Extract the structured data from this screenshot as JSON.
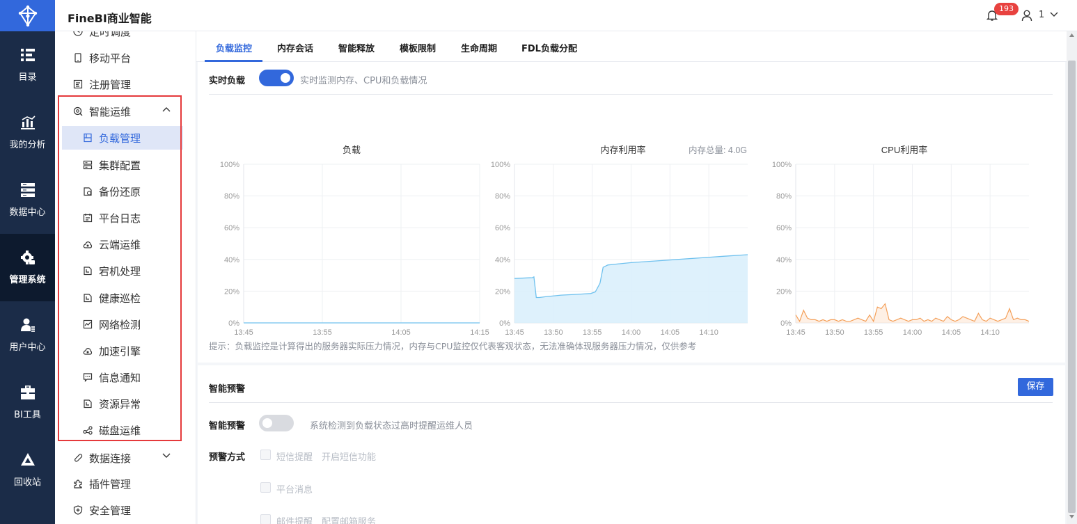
{
  "app": {
    "title": "FineBI商业智能"
  },
  "header": {
    "notification_count": "193",
    "user_name": "1"
  },
  "rail": {
    "items": [
      {
        "label": "目录",
        "icon": "catalog-icon"
      },
      {
        "label": "我的分析",
        "icon": "analysis-icon"
      },
      {
        "label": "数据中心",
        "icon": "data-center-icon"
      },
      {
        "label": "管理系统",
        "icon": "admin-gear-icon",
        "active": true
      },
      {
        "label": "用户中心",
        "icon": "user-center-icon"
      },
      {
        "label": "BI工具",
        "icon": "toolbox-icon"
      },
      {
        "label": "回收站",
        "icon": "recycle-icon"
      }
    ]
  },
  "sidebar": {
    "items": [
      {
        "label": "定时调度",
        "icon": "clock-icon"
      },
      {
        "label": "移动平台",
        "icon": "mobile-icon"
      },
      {
        "label": "注册管理",
        "icon": "register-icon"
      },
      {
        "label": "智能运维",
        "icon": "ops-icon",
        "expanded": true
      },
      {
        "label": "负载管理",
        "icon": "load-icon",
        "selected": true
      },
      {
        "label": "集群配置",
        "icon": "cluster-icon"
      },
      {
        "label": "备份还原",
        "icon": "backup-icon"
      },
      {
        "label": "平台日志",
        "icon": "log-icon"
      },
      {
        "label": "云端运维",
        "icon": "cloud-ops-icon"
      },
      {
        "label": "宕机处理",
        "icon": "downtime-icon"
      },
      {
        "label": "健康巡检",
        "icon": "health-check-icon"
      },
      {
        "label": "网络检测",
        "icon": "network-icon"
      },
      {
        "label": "加速引擎",
        "icon": "engine-icon"
      },
      {
        "label": "信息通知",
        "icon": "message-icon"
      },
      {
        "label": "资源异常",
        "icon": "resource-icon"
      },
      {
        "label": "磁盘运维",
        "icon": "disk-icon"
      },
      {
        "label": "数据连接",
        "icon": "link-icon"
      },
      {
        "label": "插件管理",
        "icon": "plugin-icon"
      },
      {
        "label": "安全管理",
        "icon": "security-icon"
      }
    ]
  },
  "tabs": [
    {
      "label": "负载监控",
      "active": true
    },
    {
      "label": "内存会话"
    },
    {
      "label": "智能释放"
    },
    {
      "label": "模板限制"
    },
    {
      "label": "生命周期"
    },
    {
      "label": "FDL负载分配"
    }
  ],
  "realtime": {
    "label": "实时负载",
    "enabled": true,
    "description": "实时监测内存、CPU和负载情况"
  },
  "hint": "提示：负载监控是计算得出的服务器实际压力情况，内存与CPU监控仅代表客观状态，无法准确体现服务器压力情况，仅供参考",
  "alert": {
    "section_title": "智能预警",
    "save_label": "保存",
    "toggle_label": "智能预警",
    "enabled": false,
    "toggle_description": "系统检测到负载状态过高时提醒运维人员",
    "method_label": "预警方式",
    "methods": [
      {
        "label": "短信提醒",
        "link": "开启短信功能"
      },
      {
        "label": "平台消息",
        "link": ""
      },
      {
        "label": "邮件提醒",
        "link": "配置邮箱服务"
      }
    ]
  },
  "colors": {
    "accent": "#3268dc",
    "memory_line": "#6fc1ee",
    "memory_fill": "#d8eefb",
    "cpu_line": "#f4a05a",
    "rail": "#1b2c48",
    "badge": "#e8423f",
    "highlight_box": "#e5393b"
  },
  "chart_data": [
    {
      "type": "line",
      "title": "负载",
      "ylim": [
        0,
        100
      ],
      "yticks": [
        "100%",
        "80%",
        "60%",
        "40%",
        "20%",
        "0%"
      ],
      "x_ticks": [
        "13:45",
        "13:55",
        "14:05",
        "14:15"
      ],
      "x_range_min": [
        0,
        30
      ],
      "series": [
        {
          "x": [
            0,
            30
          ],
          "values": [
            0,
            0
          ]
        }
      ]
    },
    {
      "type": "area",
      "title": "内存利用率",
      "subtitle": "内存总量: 4.0G",
      "ylim": [
        0,
        100
      ],
      "yticks": [
        "100%",
        "80%",
        "60%",
        "40%",
        "20%",
        "0%"
      ],
      "x_ticks": [
        "13:45",
        "13:50",
        "13:55",
        "14:00",
        "14:05",
        "14:10"
      ],
      "x_range_min": [
        0,
        30
      ],
      "series": [
        {
          "x": [
            0,
            2.3,
            2.5,
            2.8,
            3.2,
            4,
            6,
            8,
            9.8,
            10.4,
            11,
            11.4,
            12,
            13,
            15,
            18,
            21,
            24,
            27,
            30
          ],
          "values": [
            28,
            28.5,
            29,
            16,
            16,
            16.5,
            17.5,
            18,
            18.5,
            19.5,
            25,
            35,
            36.5,
            37,
            38,
            39,
            40,
            41,
            42,
            43
          ]
        }
      ]
    },
    {
      "type": "line",
      "title": "CPU利用率",
      "ylim": [
        0,
        100
      ],
      "yticks": [
        "100%",
        "80%",
        "60%",
        "40%",
        "20%",
        "0%"
      ],
      "x_ticks": [
        "13:45",
        "13:50",
        "13:55",
        "14:00",
        "14:05",
        "14:10"
      ],
      "x_range_min": [
        0,
        30
      ],
      "series": [
        {
          "x": [
            0,
            0.5,
            1,
            1.5,
            2,
            2.5,
            3,
            3.5,
            4,
            4.5,
            5,
            5.5,
            6,
            6.5,
            7,
            7.5,
            8,
            8.5,
            9,
            9.5,
            10,
            10.5,
            11,
            11.5,
            12,
            12.5,
            13,
            13.5,
            14,
            14.5,
            15,
            15.5,
            16,
            16.5,
            17,
            17.5,
            18,
            18.5,
            19,
            19.5,
            20,
            20.5,
            21,
            21.5,
            22,
            22.5,
            23,
            23.5,
            24,
            24.5,
            25,
            25.5,
            26,
            26.5,
            27,
            27.5,
            28,
            28.5,
            29,
            29.5,
            30
          ],
          "values": [
            5,
            1,
            8,
            3,
            2,
            2,
            1,
            2,
            1,
            2,
            2,
            1,
            2,
            1,
            1,
            2,
            3,
            2,
            1,
            5,
            1,
            10,
            9,
            12,
            2,
            1,
            2,
            3,
            2,
            1,
            2,
            2,
            3,
            1,
            2,
            1,
            3,
            2,
            1,
            4,
            2,
            1,
            2,
            4,
            3,
            2,
            1,
            6,
            2,
            1,
            3,
            2,
            1,
            2,
            3,
            9,
            2,
            3,
            2,
            2,
            1
          ]
        }
      ]
    }
  ]
}
